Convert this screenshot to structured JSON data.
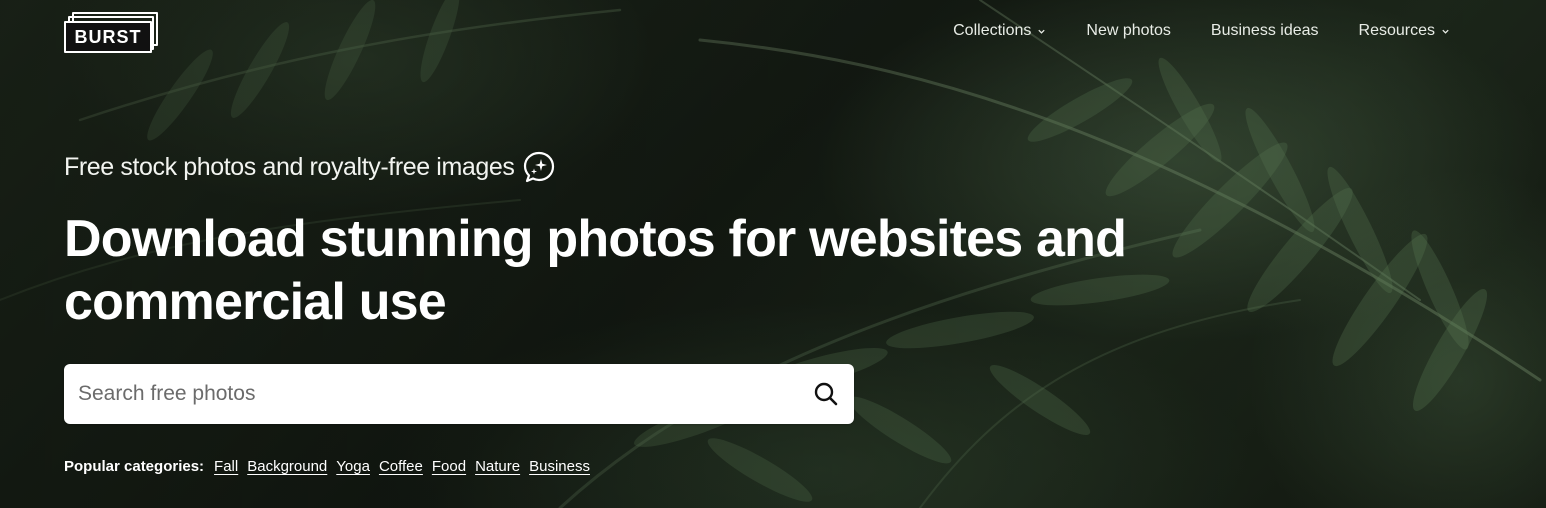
{
  "brand": {
    "logo_text": "BURST"
  },
  "nav": {
    "items": [
      {
        "label": "Collections",
        "has_dropdown": true
      },
      {
        "label": "New photos",
        "has_dropdown": false
      },
      {
        "label": "Business ideas",
        "has_dropdown": false
      },
      {
        "label": "Resources",
        "has_dropdown": true
      }
    ]
  },
  "hero": {
    "tagline": "Free stock photos and royalty-free images",
    "tagline_icon": "sparkle-chat-icon",
    "headline": "Download stunning photos for websites and commercial use"
  },
  "search": {
    "placeholder": "Search free photos",
    "value": "",
    "button_icon": "search-icon"
  },
  "popular": {
    "label": "Popular categories:",
    "categories": [
      "Fall",
      "Background",
      "Yoga",
      "Coffee",
      "Food",
      "Nature",
      "Business"
    ]
  },
  "colors": {
    "text": "#ffffff",
    "search_bg": "#ffffff",
    "background_dark": "#1a2218"
  }
}
